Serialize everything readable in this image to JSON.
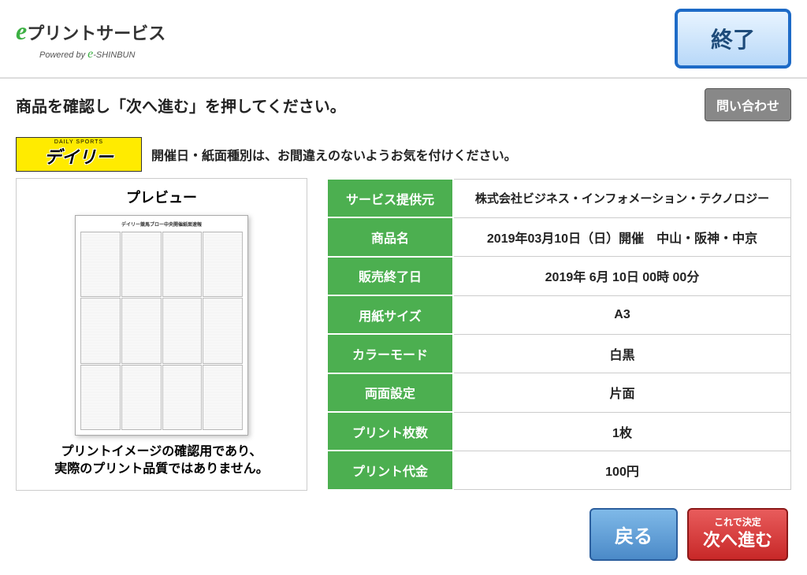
{
  "header": {
    "logo_main_prefix": "e",
    "logo_main": "プリントサービス",
    "logo_sub_prefix": "Powered by ",
    "logo_sub_e": "e",
    "logo_sub_rest": "-SHINBUN",
    "exit_label": "終了"
  },
  "instruction": {
    "text": "商品を確認し「次へ進む」を押してください。",
    "contact_label": "問い合わせ"
  },
  "banner": {
    "sports_top": "DAILY SPORTS",
    "sports_main": "デイリー",
    "message": "開催日・紙面種別は、お間違えのないようお気を付けください。"
  },
  "preview": {
    "title": "プレビュー",
    "note_line1": "プリントイメージの確認用であり、",
    "note_line2": "実際のプリント品質ではありません。"
  },
  "details": {
    "rows": [
      {
        "label": "サービス提供元",
        "value": "株式会社ビジネス・インフォメーション・テクノロジー"
      },
      {
        "label": "商品名",
        "value": "2019年03月10日（日）開催　中山・阪神・中京"
      },
      {
        "label": "販売終了日",
        "value": "2019年 6月 10日 00時 00分"
      },
      {
        "label": "用紙サイズ",
        "value": "A3"
      },
      {
        "label": "カラーモード",
        "value": "白黒"
      },
      {
        "label": "両面設定",
        "value": "片面"
      },
      {
        "label": "プリント枚数",
        "value": "1枚"
      },
      {
        "label": "プリント代金",
        "value": "100円"
      }
    ]
  },
  "footer": {
    "back_label": "戻る",
    "next_top": "これで決定",
    "next_bottom": "次へ進む"
  }
}
